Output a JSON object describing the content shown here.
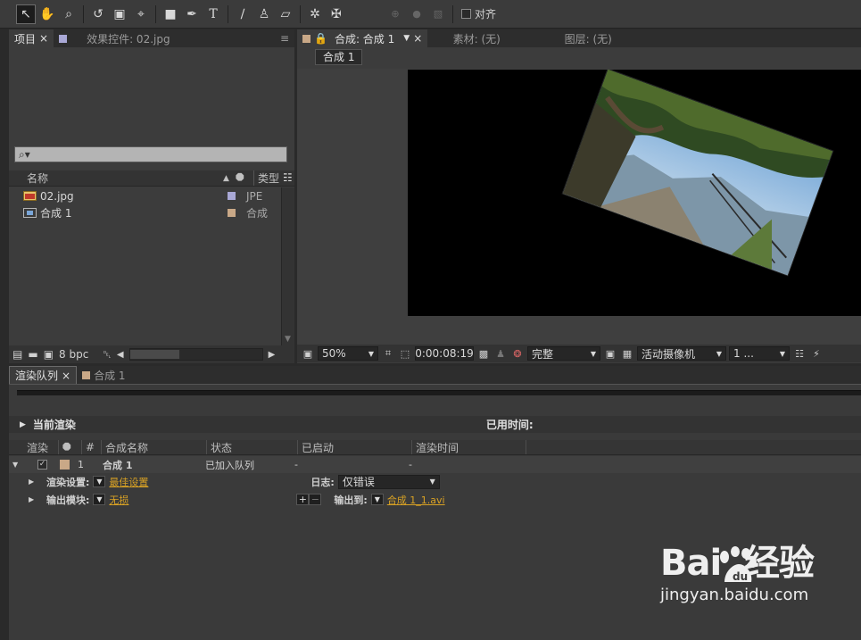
{
  "toolbar": {
    "tools": [
      "selection-tool",
      "hand-tool",
      "zoom-tool",
      "rotate-tool",
      "camera-tool",
      "pan-behind-tool",
      "rectangle-tool",
      "pen-tool",
      "text-tool",
      "brush-tool",
      "clone-stamp-tool",
      "eraser-tool",
      "roto-brush-tool",
      "puppet-tool"
    ],
    "align_label": "对齐"
  },
  "project_panel": {
    "tab_label": "项目",
    "effects_tab_label": "效果控件: 02.jpg",
    "search_placeholder": "⌕▾",
    "col_name": "名称",
    "col_type": "类型",
    "items": [
      {
        "name": "02.jpg",
        "type": "JPE",
        "swatch": "#a9a8d6"
      },
      {
        "name": "合成 1",
        "type": "合成",
        "swatch": "#c9a887"
      }
    ],
    "bpc": "8 bpc"
  },
  "comp_panel": {
    "tab_label": "合成: 合成 1",
    "footage_label": "素材: (无)",
    "layer_label": "图层: (无)",
    "subtab": "合成 1",
    "zoom": "50%",
    "timecode": "0:00:08:19",
    "resolution": "完整",
    "camera": "活动摄像机",
    "views": "1 ..."
  },
  "render_queue": {
    "tab_label": "渲染队列",
    "comp_tab_label": "合成 1",
    "current_render": "当前渲染",
    "elapsed_label": "已用时间:",
    "headers": {
      "render": "渲染",
      "num": "#",
      "comp_name": "合成名称",
      "status": "状态",
      "started": "已启动",
      "render_time": "渲染时间"
    },
    "item": {
      "num": "1",
      "comp_name": "合成 1",
      "status": "已加入队列",
      "started": "-",
      "render_time": "-"
    },
    "render_settings_label": "渲染设置:",
    "render_settings_value": "最佳设置",
    "log_label": "日志:",
    "log_value": "仅错误",
    "output_module_label": "输出模块:",
    "output_module_value": "无损",
    "output_to_label": "输出到:",
    "output_to_value": "合成 1_1.avi"
  },
  "watermark": {
    "brand": "Bai  经验",
    "url": "jingyan.baidu.com"
  }
}
